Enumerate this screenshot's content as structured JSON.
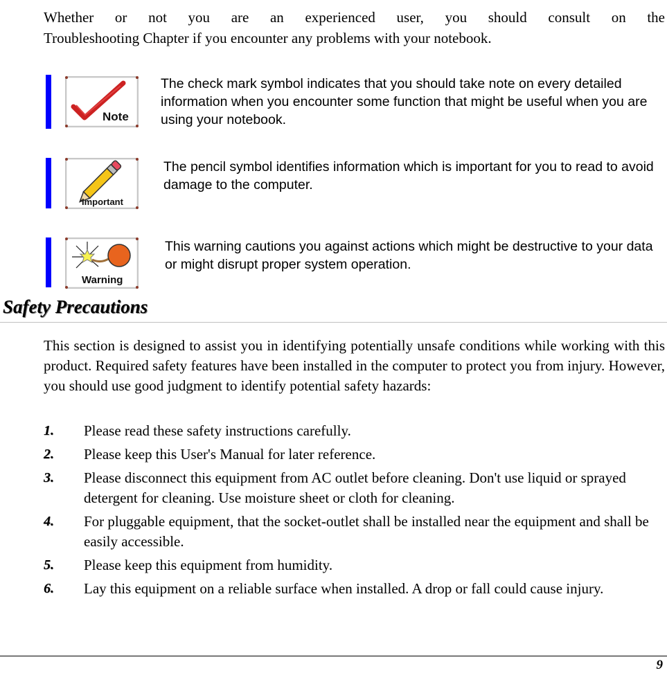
{
  "intro": {
    "line1": "Whether or not you are an experienced user, you should consult on the",
    "line2": "Troubleshooting Chapter if you encounter any problems with your notebook."
  },
  "notices": [
    {
      "icon": "check-mark-note-icon",
      "icon_label": "Note",
      "text": "The check mark symbol indicates that you should take note on every detailed information when you encounter some function that might be useful when you are using your notebook."
    },
    {
      "icon": "pencil-important-icon",
      "icon_label": "Important",
      "text": "The pencil symbol identifies information which is important for you to read to avoid damage to the computer."
    },
    {
      "icon": "bomb-warning-icon",
      "icon_label": "Warning",
      "text": "This warning cautions you against actions which might be destructive to your data or might disrupt proper system operation."
    }
  ],
  "section": {
    "title": "Safety Precautions",
    "paragraph": "This section is designed to assist you in identifying potentially unsafe conditions while working with this product.  Required safety features have been installed in the computer to protect you from injury.  However, you should use good judgment to identify potential safety hazards:"
  },
  "list": [
    {
      "num": "1.",
      "text": "Please read these safety instructions carefully."
    },
    {
      "num": "2.",
      "text": "Please keep this User's Manual for later reference."
    },
    {
      "num": "3.",
      "text": "Please disconnect this equipment from AC outlet before cleaning.  Don't use liquid or sprayed detergent for cleaning.  Use moisture sheet or cloth for cleaning."
    },
    {
      "num": "4.",
      "text": "For pluggable equipment, that the socket-outlet shall be installed near the equipment and shall be easily accessible."
    },
    {
      "num": "5.",
      "text": "Please keep this equipment from humidity."
    },
    {
      "num": "6.",
      "text": "Lay this equipment on a reliable surface when installed.  A drop or fall could cause injury."
    }
  ],
  "footer": {
    "page_number": "9"
  },
  "colors": {
    "accent_bar": "#0000ff",
    "check_red": "#cc2222",
    "bomb_orange": "#e8641e"
  }
}
